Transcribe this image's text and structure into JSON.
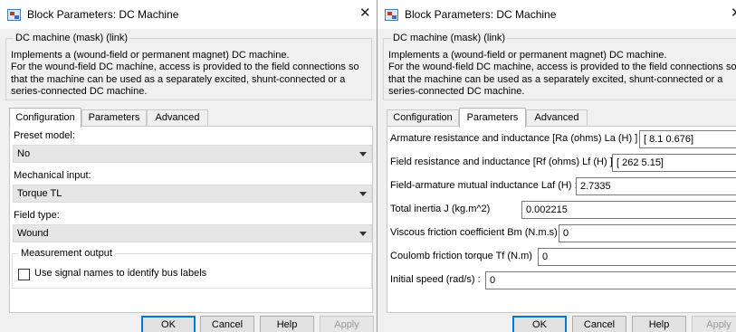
{
  "dialog_left": {
    "title": "Block Parameters: DC Machine",
    "close_symbol": "✕",
    "mask_title": "DC machine (mask) (link)",
    "mask_description": [
      "Implements a (wound-field or permanent magnet) DC machine.",
      "For the wound-field DC machine, access is provided to the field connections so",
      "that the machine can be used as a separately excited, shunt-connected or a",
      "series-connected  DC machine."
    ],
    "tabs": [
      {
        "label": "Configuration",
        "active": true
      },
      {
        "label": "Parameters",
        "active": false
      },
      {
        "label": "Advanced",
        "active": false
      }
    ],
    "configuration": {
      "preset_model_label": "Preset  model:",
      "preset_model_value": "No",
      "mechanical_input_label": "Mechanical input:",
      "mechanical_input_value": "Torque TL",
      "field_type_label": "Field type:",
      "field_type_value": "Wound",
      "measurement_output_title": "Measurement output",
      "use_signal_names_label": "Use signal names to identify bus labels",
      "use_signal_names_checked": false
    },
    "buttons": {
      "ok": "OK",
      "cancel": "Cancel",
      "help": "Help",
      "apply": "Apply"
    }
  },
  "dialog_right": {
    "title": "Block Parameters: DC Machine",
    "close_symbol": "✕",
    "mask_title": "DC machine (mask) (link)",
    "mask_description": [
      "Implements a (wound-field or permanent magnet) DC machine.",
      "For the wound-field DC machine, access is provided to the field connections so",
      "that the machine can be used as a separately excited, shunt-connected or a",
      "series-connected  DC machine."
    ],
    "tabs": [
      {
        "label": "Configuration",
        "active": false
      },
      {
        "label": "Parameters",
        "active": true
      },
      {
        "label": "Advanced",
        "active": false
      }
    ],
    "parameters": [
      {
        "label": "Armature resistance and inductance [Ra (ohms) La (H) ]",
        "value": "[ 8.1  0.676]"
      },
      {
        "label": "Field resistance and inductance [Rf (ohms) Lf (H) ]",
        "value": "[ 262  5.15]"
      },
      {
        "label": "Field-armature mutual inductance Laf (H) :",
        "value": "2.7335"
      },
      {
        "label": "Total inertia J (kg.m^2)",
        "value": "0.002215"
      },
      {
        "label": "Viscous friction coefficient Bm (N.m.s)",
        "value": "0"
      },
      {
        "label": "Coulomb friction torque Tf (N.m)",
        "value": "0"
      },
      {
        "label": "Initial speed (rad/s) :",
        "value": "0"
      }
    ],
    "buttons": {
      "ok": "OK",
      "cancel": "Cancel",
      "help": "Help",
      "apply": "Apply"
    }
  },
  "colors": {
    "ok_button_border": "#0078d7",
    "window_background": "#f0f0f0"
  }
}
